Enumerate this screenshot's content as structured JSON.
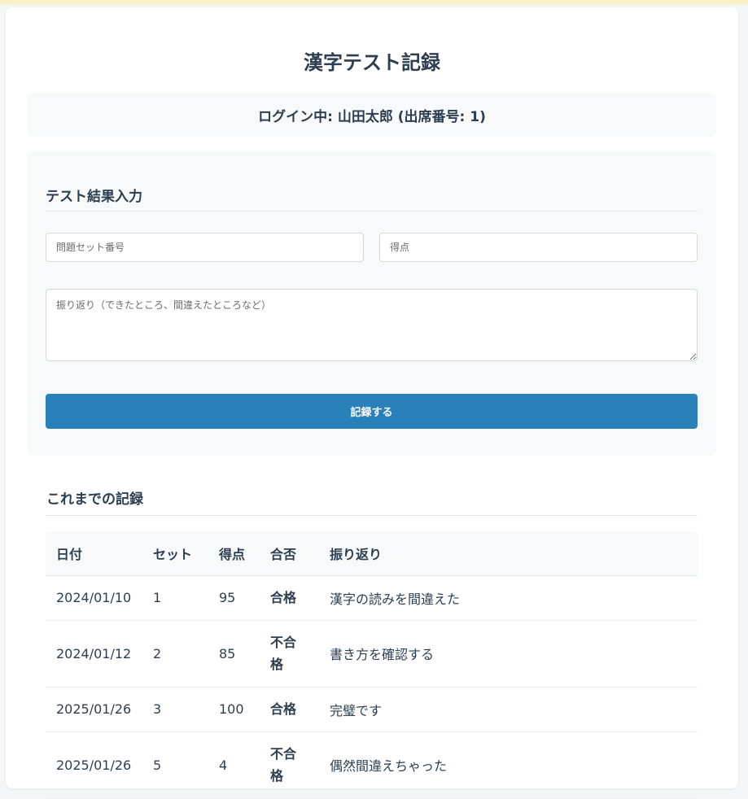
{
  "page": {
    "title": "漢字テスト記録",
    "login_text": "ログイン中: 山田太郎 (出席番号: 1)"
  },
  "form": {
    "section_title": "テスト結果入力",
    "set_number_placeholder": "問題セット番号",
    "score_placeholder": "得点",
    "reflection_placeholder": "振り返り（できたところ、間違えたところなど）",
    "submit_label": "記録する"
  },
  "records": {
    "section_title": "これまでの記録",
    "headers": {
      "date": "日付",
      "set": "セット",
      "score": "得点",
      "result": "合否",
      "reflection": "振り返り"
    },
    "rows": [
      {
        "date": "2024/01/10",
        "set": "1",
        "score": "95",
        "result": "合格",
        "status": "pass",
        "reflection": "漢字の読みを間違えた"
      },
      {
        "date": "2024/01/12",
        "set": "2",
        "score": "85",
        "result": "不合格",
        "status": "fail",
        "reflection": "書き方を確認する"
      },
      {
        "date": "2025/01/26",
        "set": "3",
        "score": "100",
        "result": "合格",
        "status": "pass",
        "reflection": "完璧です"
      },
      {
        "date": "2025/01/26",
        "set": "5",
        "score": "4",
        "result": "不合格",
        "status": "fail",
        "reflection": "偶然間違えちゃった"
      }
    ]
  },
  "colors": {
    "accent": "#2a80b9",
    "pass": "#27ae60",
    "fail": "#e74c3c",
    "text": "#2c3e50",
    "panel": "#f7f9fa"
  }
}
